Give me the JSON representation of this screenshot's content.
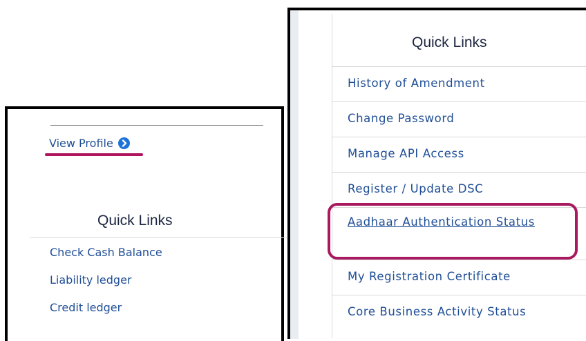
{
  "profile": {
    "view_profile_label": "View Profile"
  },
  "left_quick_links": {
    "title": "Quick Links",
    "items": [
      {
        "label": "Check Cash Balance"
      },
      {
        "label": "Liability ledger"
      },
      {
        "label": "Credit ledger"
      }
    ]
  },
  "right_quick_links": {
    "title": "Quick Links",
    "items": [
      {
        "label": "History of Amendment"
      },
      {
        "label": "Change Password"
      },
      {
        "label": "Manage API Access"
      },
      {
        "label": "Register / Update DSC"
      },
      {
        "label": "Aadhaar Authentication Status"
      },
      {
        "label": "My Registration Certificate"
      },
      {
        "label": "Core Business Activity Status"
      }
    ]
  },
  "colors": {
    "link": "#1f4e96",
    "highlight": "#a8195f",
    "view_profile_icon": "#1d73d8"
  },
  "icons": {
    "view_profile": "chevron-right-circle-icon"
  }
}
